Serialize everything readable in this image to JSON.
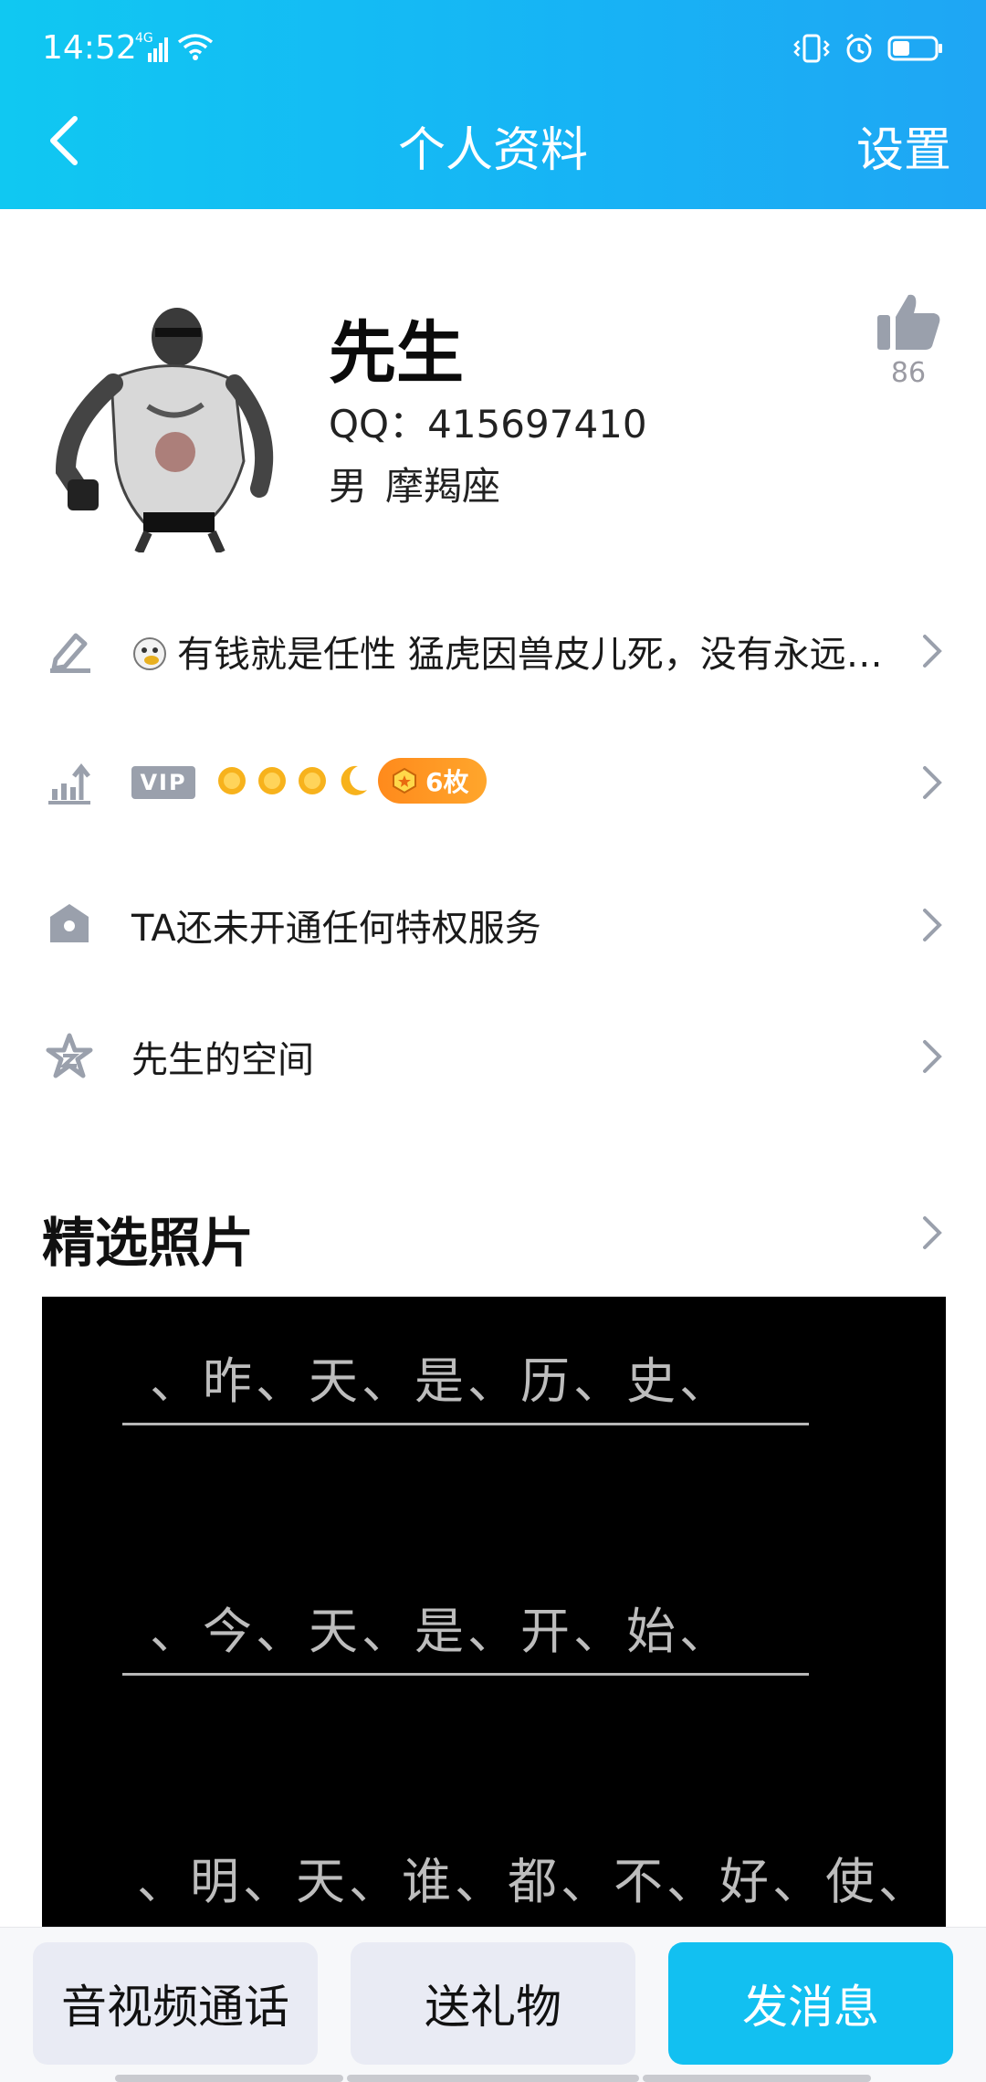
{
  "status_bar": {
    "time": "14:52",
    "network": "4G",
    "icons": [
      "signal-icon",
      "wifi-icon",
      "vibrate-icon",
      "alarm-icon",
      "battery-icon"
    ]
  },
  "nav": {
    "title": "个人资料",
    "settings_label": "设置",
    "back_icon": "back-arrow-icon"
  },
  "profile": {
    "nickname": "先生",
    "qq": "QQ：415697410",
    "gender": "男",
    "zodiac": "摩羯座",
    "likes": "86"
  },
  "rows": {
    "signature": "有钱就是任性 猛虎因兽皮儿死，没有永远…",
    "vip_label": "VIP",
    "medal_count": "6枚",
    "privilege": "TA还未开通任何特权服务",
    "space": "先生的空间"
  },
  "photos": {
    "section_title": "精选照片",
    "lines": [
      "、昨、天、是、历、史、",
      "、今、天、是、开、始、",
      "、明、天、谁、都、不、好、使、"
    ]
  },
  "actions": {
    "call": "音视频通话",
    "gift": "送礼物",
    "message": "发消息"
  },
  "colors": {
    "header_gradient_start": "#10c8f2",
    "header_gradient_end": "#1fa6f4",
    "primary_button": "#12c0f1",
    "secondary_button": "#e9ebf4",
    "icon_gray": "#9aa0ac",
    "medal_orange": "#ff8a1c"
  }
}
